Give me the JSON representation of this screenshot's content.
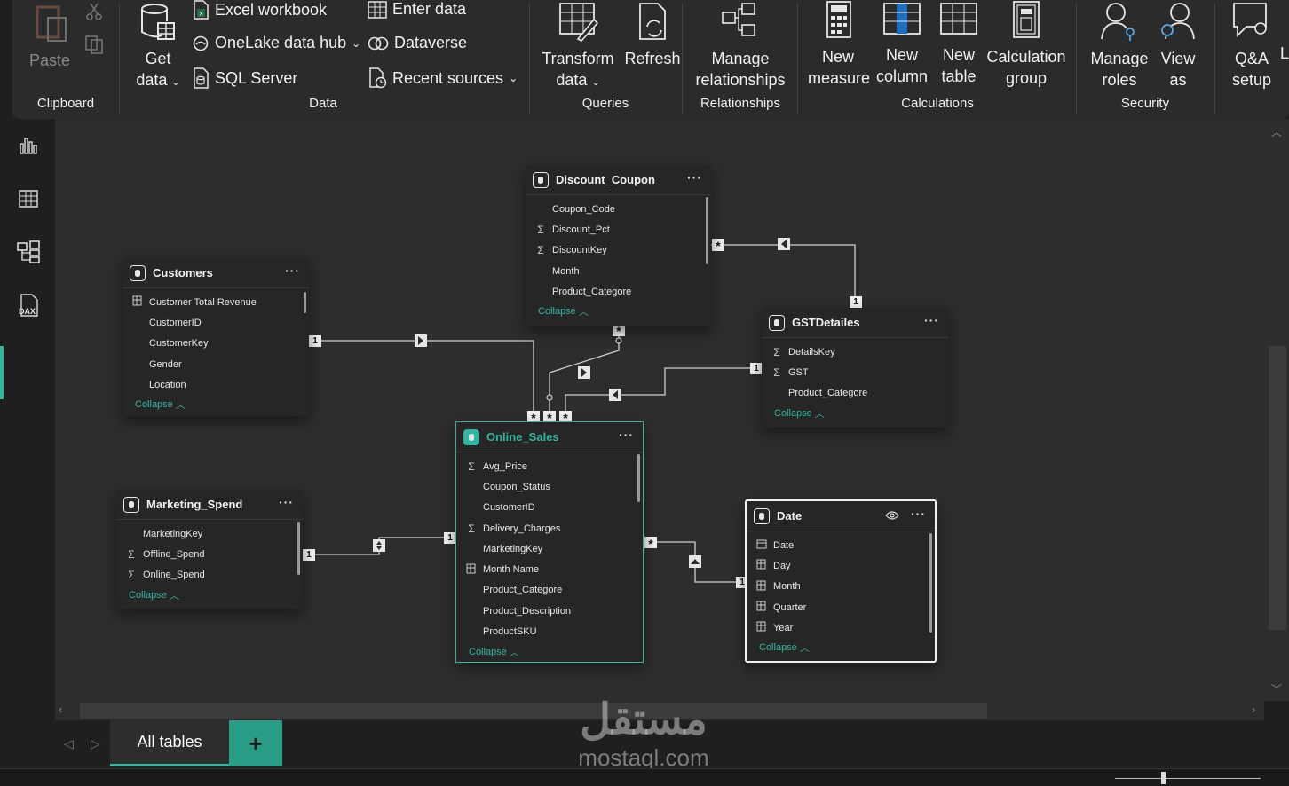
{
  "ribbon": {
    "clipboard": {
      "paste": "Paste",
      "label": "Clipboard"
    },
    "data": {
      "get_data": "Get",
      "get_data2": "data",
      "excel": "Excel workbook",
      "onelake": "OneLake data hub",
      "sql": "SQL Server",
      "enter": "Enter data",
      "dataverse": "Dataverse",
      "recent": "Recent sources",
      "label": "Data"
    },
    "queries": {
      "transform1": "Transform",
      "transform2": "data",
      "refresh": "Refresh",
      "label": "Queries"
    },
    "relationships": {
      "manage1": "Manage",
      "manage2": "relationships",
      "label": "Relationships"
    },
    "calculations": {
      "new_measure1": "New",
      "new_measure2": "measure",
      "new_column1": "New",
      "new_column2": "column",
      "new_table1": "New",
      "new_table2": "table",
      "calc_group1": "Calculation",
      "calc_group2": "group",
      "label": "Calculations"
    },
    "security": {
      "manage_roles1": "Manage",
      "manage_roles2": "roles",
      "view_as1": "View",
      "view_as2": "as",
      "label": "Security"
    },
    "qa": {
      "qa1": "Q&A",
      "qa2": "setup",
      "extra": "L"
    }
  },
  "tables": {
    "discount_coupon": {
      "title": "Discount_Coupon",
      "fields": [
        {
          "name": "Coupon_Code",
          "icon": ""
        },
        {
          "name": "Discount_Pct",
          "icon": "Σ"
        },
        {
          "name": "DiscountKey",
          "icon": "Σ"
        },
        {
          "name": "Month",
          "icon": ""
        },
        {
          "name": "Product_Categore",
          "icon": ""
        }
      ]
    },
    "customers": {
      "title": "Customers",
      "fields": [
        {
          "name": "Customer Total Revenue",
          "icon": "calc"
        },
        {
          "name": "CustomerID",
          "icon": ""
        },
        {
          "name": "CustomerKey",
          "icon": ""
        },
        {
          "name": "Gender",
          "icon": ""
        },
        {
          "name": "Location",
          "icon": ""
        }
      ]
    },
    "gstdetailes": {
      "title": "GSTDetailes",
      "fields": [
        {
          "name": "DetailsKey",
          "icon": "Σ"
        },
        {
          "name": "GST",
          "icon": "Σ"
        },
        {
          "name": "Product_Categore",
          "icon": ""
        }
      ]
    },
    "online_sales": {
      "title": "Online_Sales",
      "fields": [
        {
          "name": "Avg_Price",
          "icon": "Σ"
        },
        {
          "name": "Coupon_Status",
          "icon": ""
        },
        {
          "name": "CustomerID",
          "icon": ""
        },
        {
          "name": "Delivery_Charges",
          "icon": "Σ"
        },
        {
          "name": "MarketingKey",
          "icon": ""
        },
        {
          "name": "Month Name",
          "icon": "calc"
        },
        {
          "name": "Product_Categore",
          "icon": ""
        },
        {
          "name": "Product_Description",
          "icon": ""
        },
        {
          "name": "ProductSKU",
          "icon": ""
        }
      ]
    },
    "marketing_spend": {
      "title": "Marketing_Spend",
      "fields": [
        {
          "name": "MarketingKey",
          "icon": ""
        },
        {
          "name": "Offline_Spend",
          "icon": "Σ"
        },
        {
          "name": "Online_Spend",
          "icon": "Σ"
        }
      ]
    },
    "date": {
      "title": "Date",
      "fields": [
        {
          "name": "Date",
          "icon": "cal"
        },
        {
          "name": "Day",
          "icon": "calc"
        },
        {
          "name": "Month",
          "icon": "calc"
        },
        {
          "name": "Quarter",
          "icon": "calc"
        },
        {
          "name": "Year",
          "icon": "calc"
        }
      ]
    },
    "collapse_label": "Collapse"
  },
  "relationship_labels": {
    "one": "1",
    "many": "*"
  },
  "tabs": {
    "all_tables": "All tables",
    "add": "+"
  },
  "watermark": {
    "arabic": "مستقل",
    "latin": "mostaql.com"
  },
  "colors": {
    "accent": "#31b6a0",
    "ribbon_bg": "#2b2b2b",
    "canvas_bg": "#2d2d2d"
  }
}
